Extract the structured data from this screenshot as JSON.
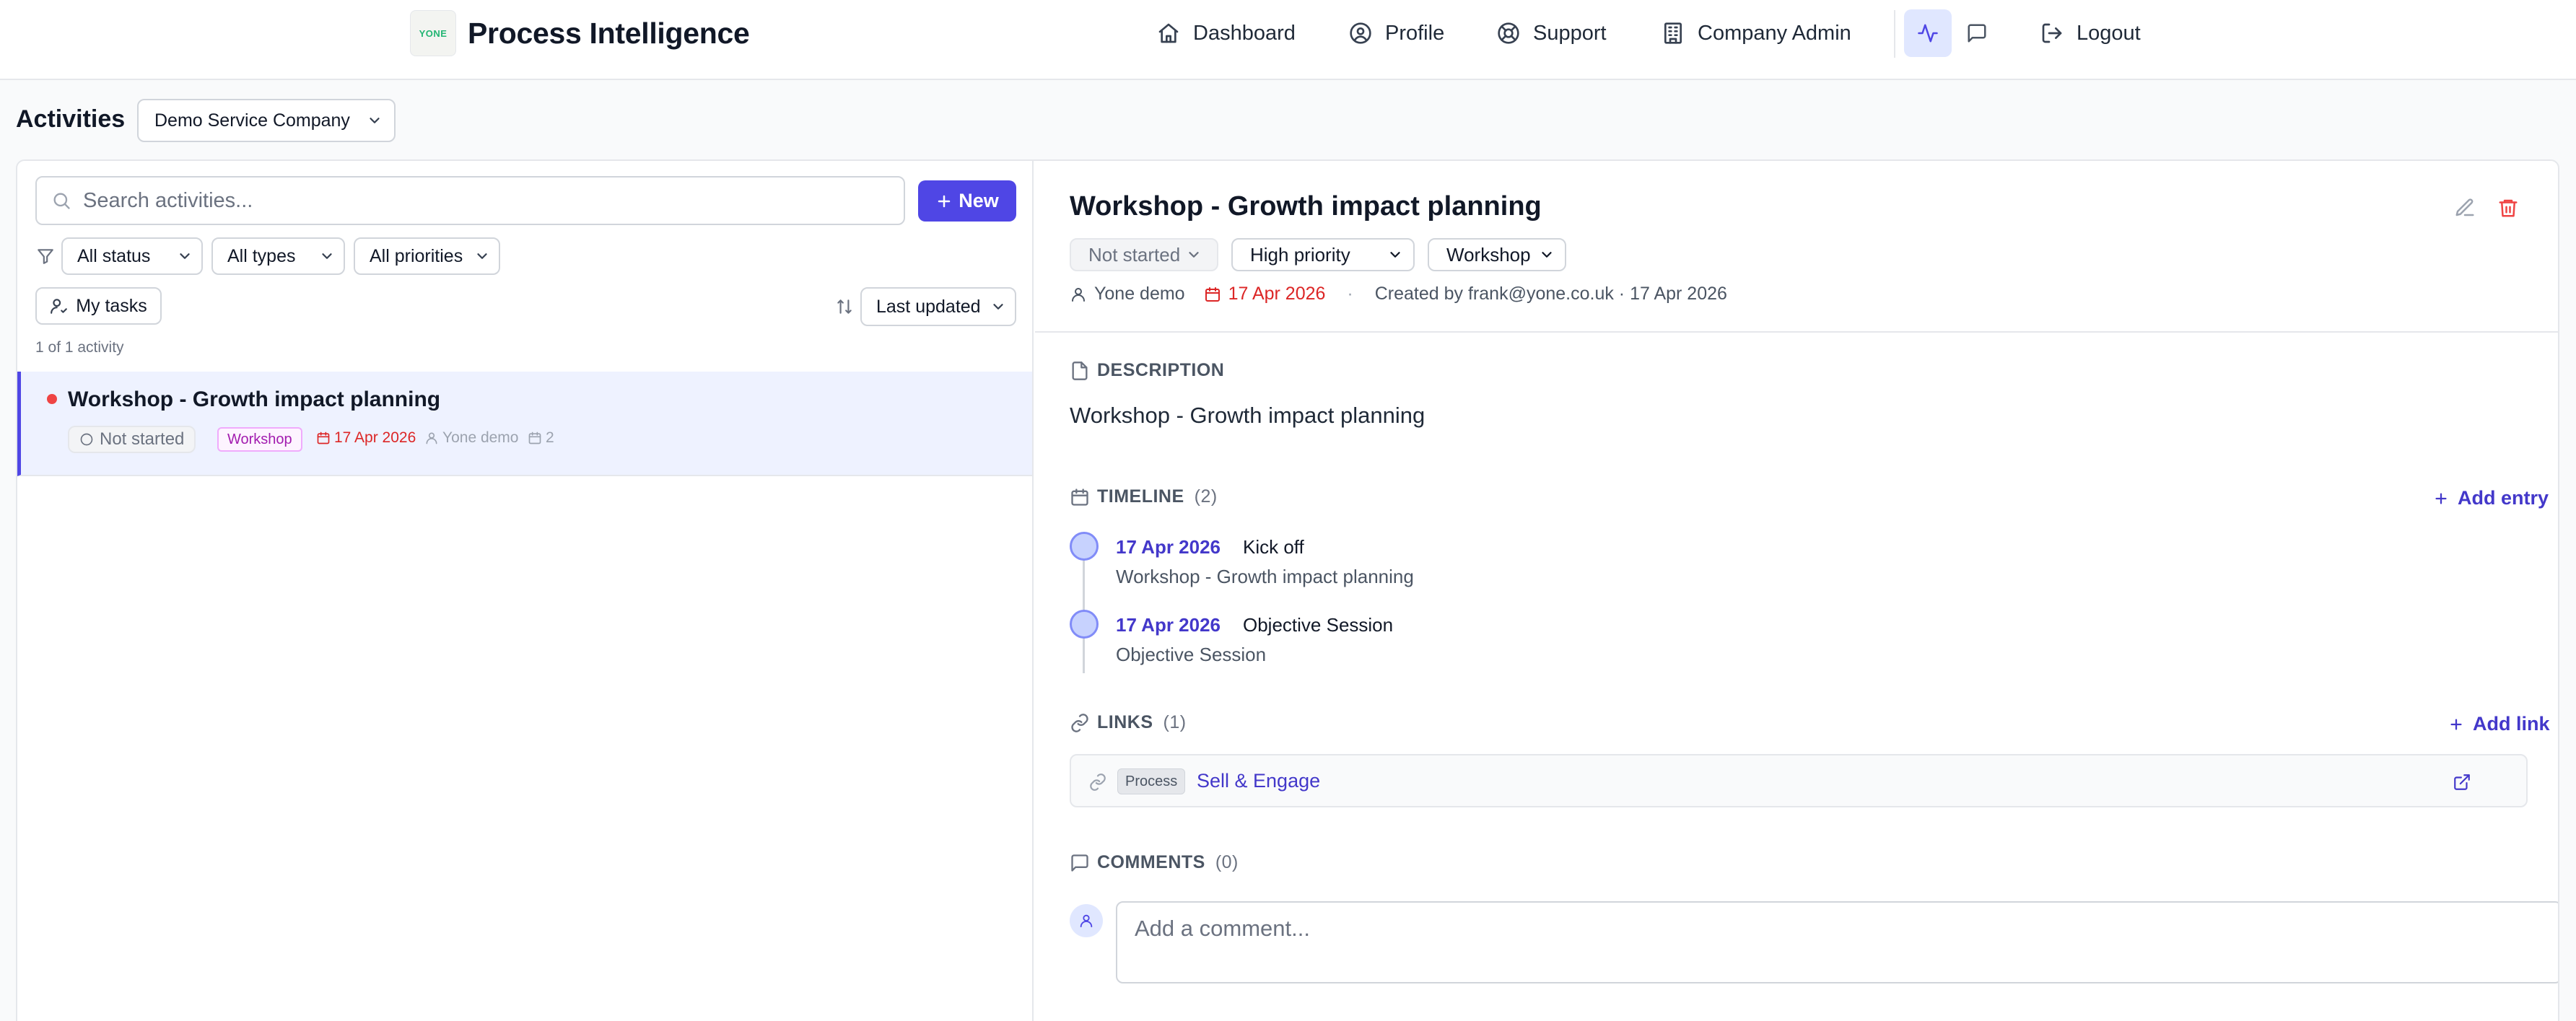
{
  "app": {
    "logo_text": "YONE",
    "title": "Process Intelligence"
  },
  "nav": {
    "items": [
      {
        "label": "Dashboard",
        "icon": "home-icon"
      },
      {
        "label": "Profile",
        "icon": "user-circle-icon"
      },
      {
        "label": "Support",
        "icon": "lifebuoy-icon"
      },
      {
        "label": "Company Admin",
        "icon": "building-icon"
      }
    ],
    "activity_icon": "activity-icon",
    "chat_icon": "chat-icon",
    "logout_label": "Logout"
  },
  "page": {
    "title": "Activities",
    "company_select": "Demo Service Company"
  },
  "list": {
    "search_placeholder": "Search activities...",
    "new_label": "New",
    "filters": {
      "status": "All status",
      "types": "All types",
      "priorities": "All priorities"
    },
    "my_tasks_label": "My tasks",
    "sort_label": "Last updated",
    "count_text": "1 of 1 activity",
    "items": [
      {
        "title": "Workshop - Growth impact planning",
        "status": "Not started",
        "type": "Workshop",
        "date": "17 Apr 2026",
        "assignee": "Yone demo",
        "count": "2"
      }
    ]
  },
  "detail": {
    "title": "Workshop - Growth impact planning",
    "status": "Not started",
    "priority": "High priority",
    "type": "Workshop",
    "assignee": "Yone demo",
    "due_date": "17 Apr 2026",
    "separator": "·",
    "created_text": "Created by frank@yone.co.uk · 17 Apr 2026",
    "description_label": "DESCRIPTION",
    "description": "Workshop - Growth impact planning",
    "timeline_label": "TIMELINE",
    "timeline_count": "(2)",
    "add_entry_label": "Add entry",
    "timeline": [
      {
        "date": "17 Apr 2026",
        "title": "Kick off",
        "desc": "Workshop - Growth impact planning"
      },
      {
        "date": "17 Apr 2026",
        "title": "Objective Session",
        "desc": "Objective Session"
      }
    ],
    "links_label": "LINKS",
    "links_count": "(1)",
    "add_link_label": "Add link",
    "links": [
      {
        "tag": "Process",
        "text": "Sell & Engage"
      }
    ],
    "comments_label": "COMMENTS",
    "comments_count": "(0)",
    "comment_placeholder": "Add a comment..."
  },
  "colors": {
    "accent": "#4f46e5",
    "danger": "#ef4444",
    "logo_green": "#22b573",
    "tag_purple": "#a21caf"
  }
}
